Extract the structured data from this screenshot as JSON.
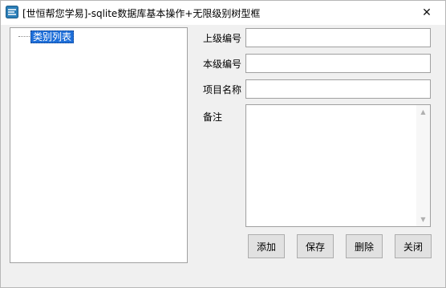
{
  "window": {
    "title": "[世恒帮您学易]-sqlite数据库基本操作+无限级别树型框",
    "close_glyph": "✕",
    "app_icon": "app-logo-icon"
  },
  "tree": {
    "root_label": "类别列表"
  },
  "form": {
    "parent_code_label": "上级编号",
    "parent_code_value": "",
    "own_code_label": "本级编号",
    "own_code_value": "",
    "item_name_label": "项目名称",
    "item_name_value": "",
    "note_label": "备注",
    "note_value": ""
  },
  "buttons": {
    "add": "添加",
    "save": "保存",
    "delete": "删除",
    "close": "关闭"
  },
  "scroll": {
    "up_glyph": "▲",
    "down_glyph": "▼"
  }
}
